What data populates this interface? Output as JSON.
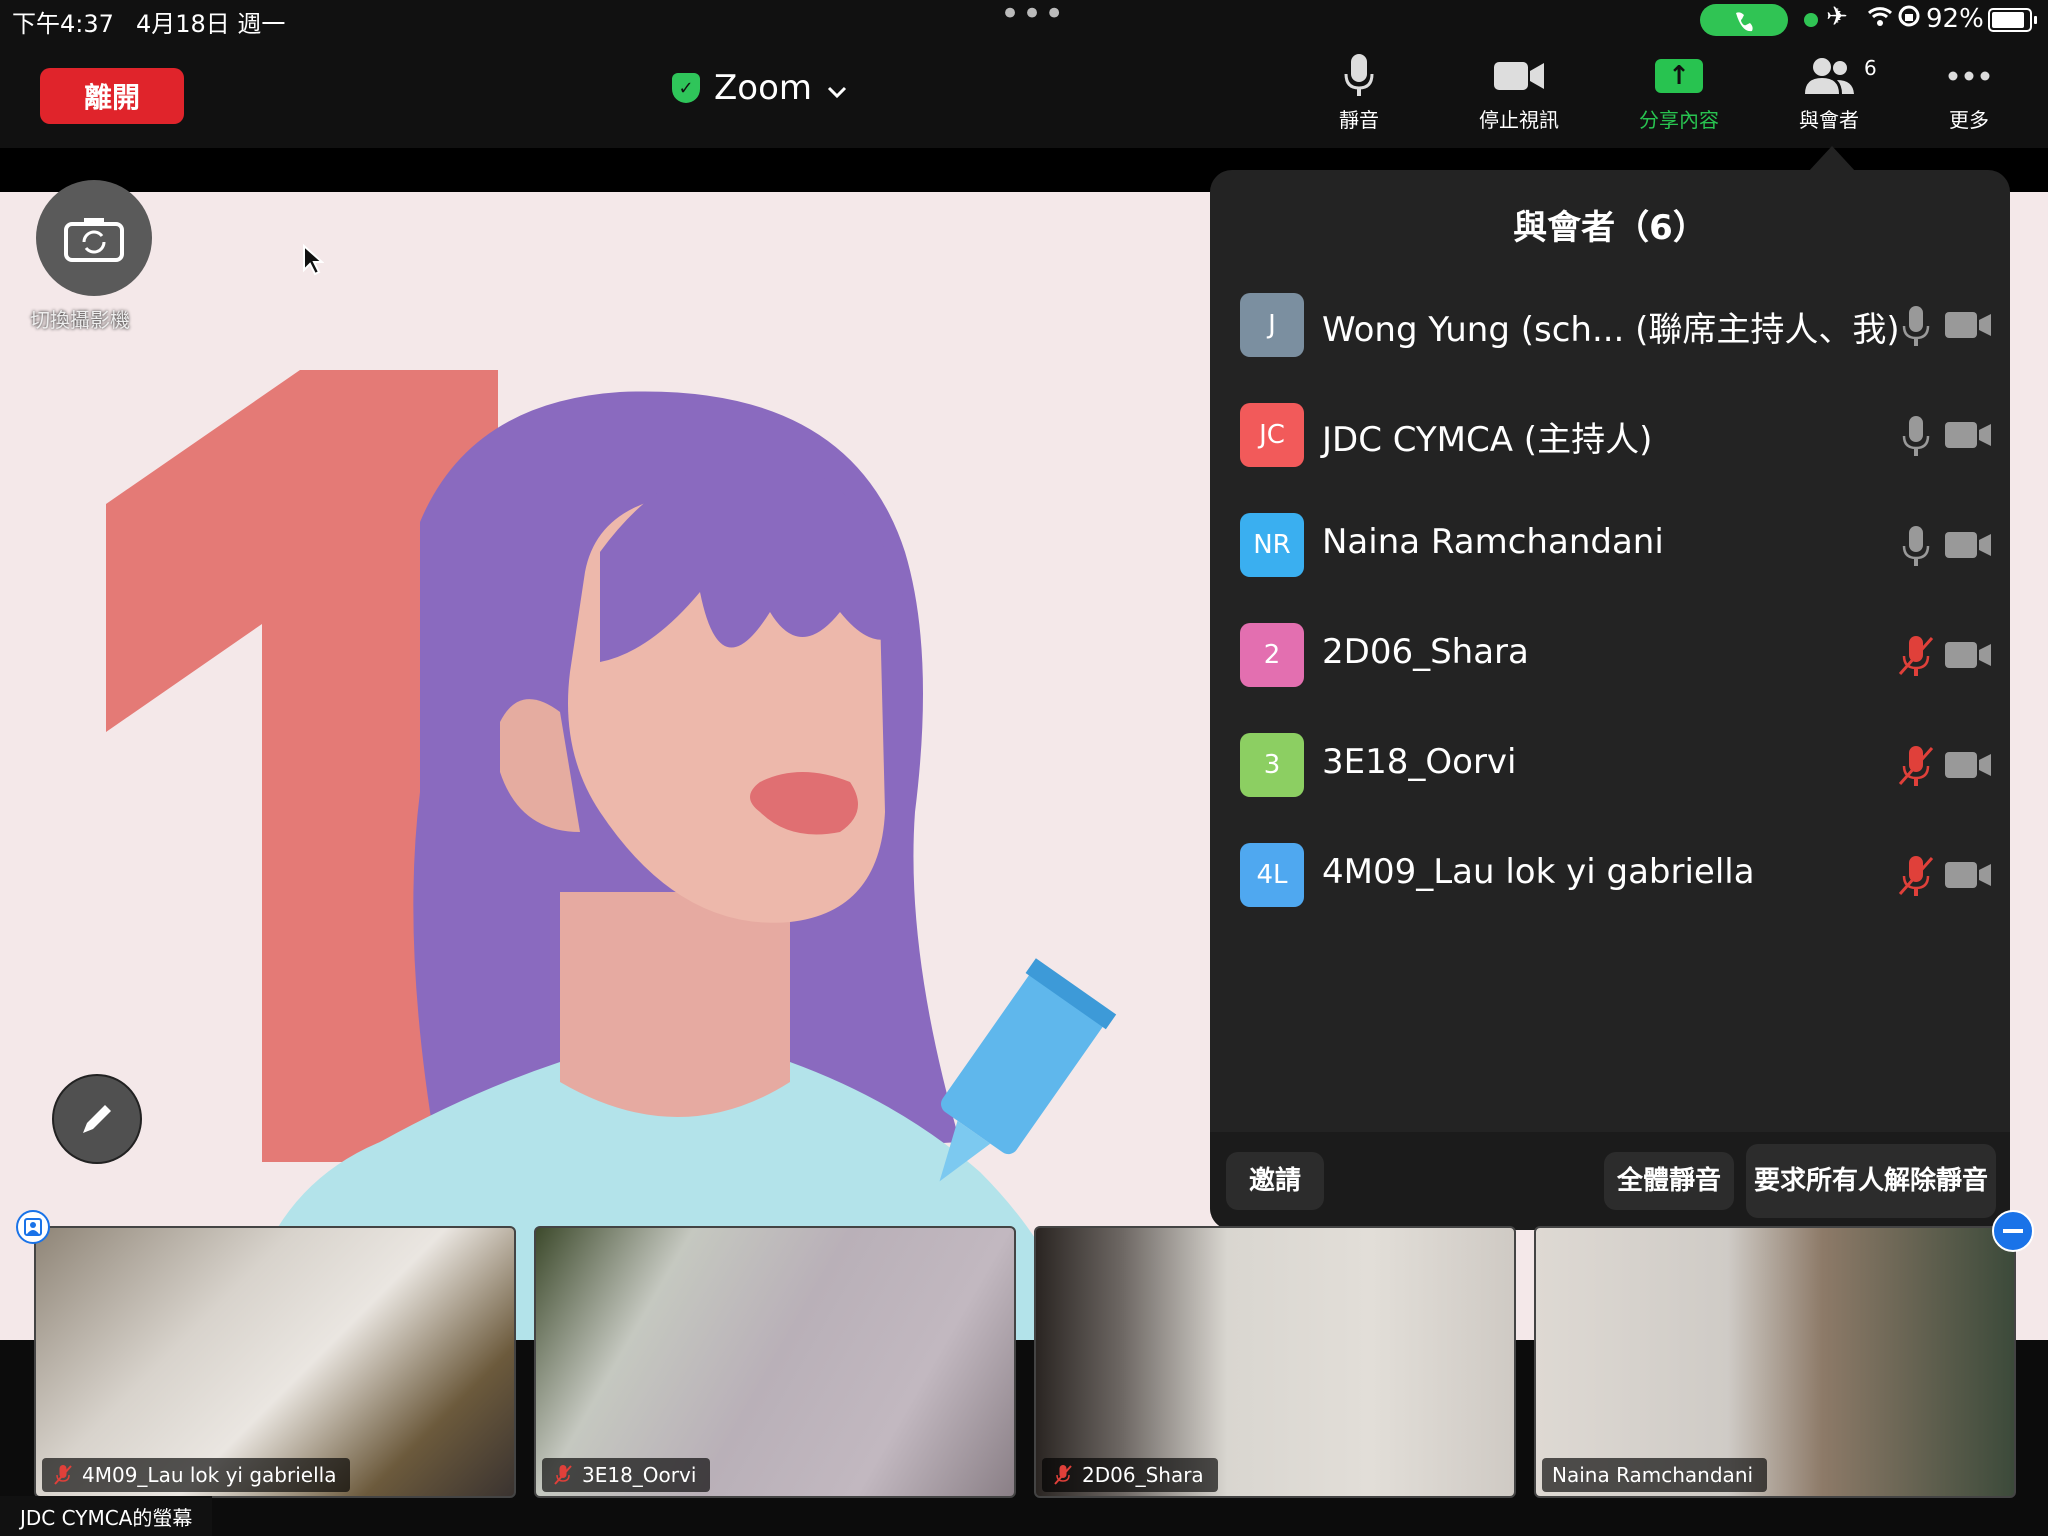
{
  "status_bar": {
    "time": "下午4:37",
    "date": "4月18日 週一",
    "battery": "92%"
  },
  "toolbar": {
    "leave_label": "離開",
    "meeting_title": "Zoom",
    "mute_label": "靜音",
    "stop_video_label": "停止視訊",
    "share_label": "分享內容",
    "participants_label": "與會者",
    "participants_count": "6",
    "more_label": "更多"
  },
  "content": {
    "switch_camera_label": "切換攝影機",
    "share_owner": "JDC CYMCA的螢幕"
  },
  "panel": {
    "title": "與會者（6）",
    "participants": [
      {
        "initials": "J",
        "name": "Wong Yung (sch...  (聯席主持人、我)",
        "color": "#7b8fa0",
        "muted": false
      },
      {
        "initials": "JC",
        "name": "JDC CYMCA (主持人)",
        "color": "#f25a5a",
        "muted": false
      },
      {
        "initials": "NR",
        "name": "Naina Ramchandani",
        "color": "#3aaff0",
        "muted": false
      },
      {
        "initials": "2",
        "name": "2D06_Shara",
        "color": "#e36fb0",
        "muted": true
      },
      {
        "initials": "3",
        "name": "3E18_Oorvi",
        "color": "#8ccf62",
        "muted": true
      },
      {
        "initials": "4L",
        "name": "4M09_Lau lok yi gabriella",
        "color": "#4fa8f0",
        "muted": true
      }
    ],
    "invite_label": "邀請",
    "mute_all_label": "全體靜音",
    "ask_unmute_label": "要求所有人解除靜音"
  },
  "thumbnails": [
    {
      "name": "4M09_Lau lok yi gabriella",
      "muted": true
    },
    {
      "name": "3E18_Oorvi",
      "muted": true
    },
    {
      "name": "2D06_Shara",
      "muted": true
    },
    {
      "name": "Naina Ramchandani",
      "muted": false
    }
  ],
  "colors": {
    "leave": "#e0242b",
    "share_green": "#28c350",
    "muted_red": "#e0403a",
    "panel_bg": "#232323"
  }
}
